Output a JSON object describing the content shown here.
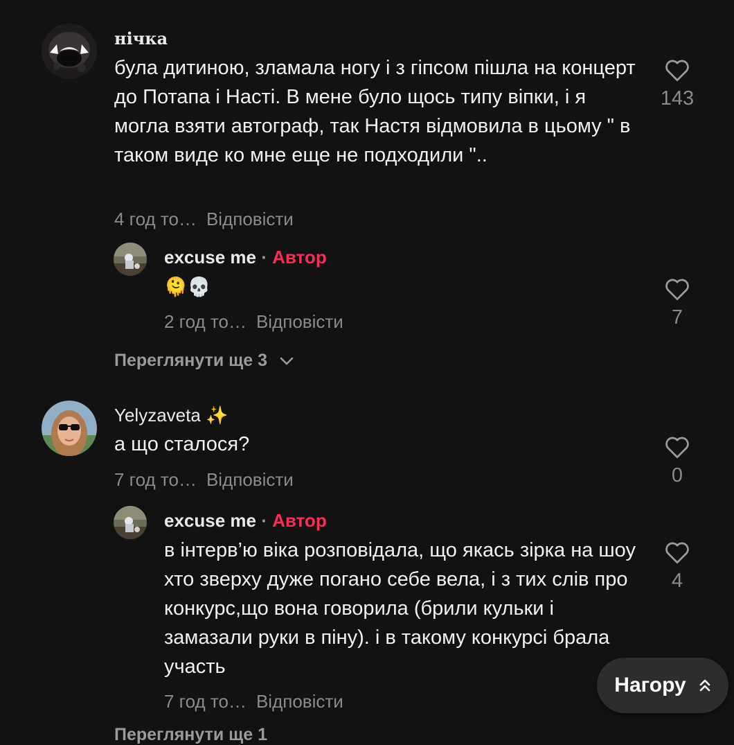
{
  "comments": [
    {
      "user": "нічка",
      "text": "була дитиною, зламала ногу і з гіпсом пішла на концерт до Потапа і Насті. В мене було щось типу віпки, і я могла взяти автограф, так Настя відмовила в цьому \" в таком виде ко мне еще не подходили \"..",
      "time": "4 год то…",
      "reply_label": "Відповісти",
      "likes": "143"
    },
    {
      "user": "excuse me",
      "separator": "·",
      "badge": "Автор",
      "text": "🫠💀",
      "time": "2 год то…",
      "reply_label": "Відповісти",
      "likes": "7"
    },
    {
      "user": "Yelyzaveta",
      "user_emoji": "✨",
      "text": "а що сталося?",
      "time": "7 год то…",
      "reply_label": "Відповісти",
      "likes": "0"
    },
    {
      "user": "excuse me",
      "separator": "·",
      "badge": "Автор",
      "text": "в інтерв’ю віка розповідала, що якась зірка на шоу хто зверху дуже погано себе вела, і з тих слів про конкурс,що вона говорила (брили кульки і замазали руки в піну). і в такому конкурсі брала участь",
      "time": "7 год то…",
      "reply_label": "Відповісти",
      "likes": "4"
    }
  ],
  "view_more_1": "Переглянути ще 3",
  "view_more_2": "Переглянути ще 1",
  "back_to_top": "Нагору",
  "icons": {
    "like": "heart-outline-icon",
    "expand": "chevron-down-icon",
    "top": "double-chevron-up-icon"
  },
  "colors": {
    "background": "#121212",
    "author_badge": "#fe2c55",
    "muted": "#8b8b8b"
  }
}
